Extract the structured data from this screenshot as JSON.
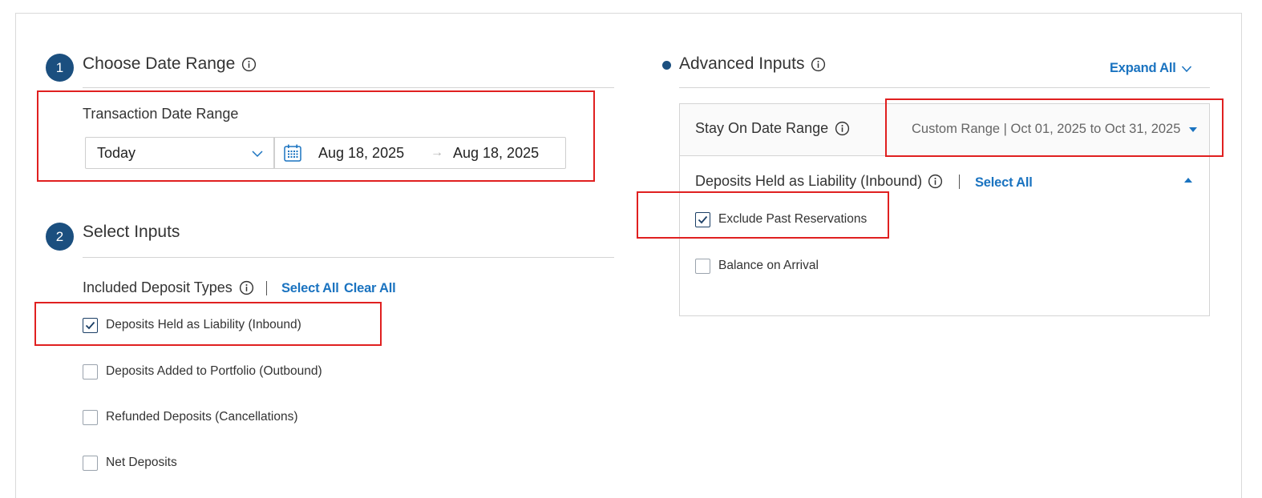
{
  "left": {
    "step1": {
      "number": "1",
      "title": "Choose Date Range",
      "field_label": "Transaction Date Range",
      "preset_value": "Today",
      "start_date": "Aug 18, 2025",
      "arrow": "→",
      "end_date": "Aug 18, 2025"
    },
    "step2": {
      "number": "2",
      "title": "Select Inputs",
      "group_label": "Included Deposit Types",
      "select_all": "Select All",
      "clear_all": "Clear All",
      "options": [
        {
          "label": "Deposits Held as Liability (Inbound)",
          "checked": true
        },
        {
          "label": "Deposits Added to Portfolio (Outbound)",
          "checked": false
        },
        {
          "label": "Refunded Deposits (Cancellations)",
          "checked": false
        },
        {
          "label": "Net Deposits",
          "checked": false
        }
      ]
    }
  },
  "right": {
    "title": "Advanced Inputs",
    "expand_all": "Expand All",
    "stay_range": {
      "label": "Stay On Date Range",
      "value": "Custom Range | Oct 01, 2025 to Oct 31, 2025"
    },
    "inbound_group": {
      "label": "Deposits Held as Liability (Inbound)",
      "select_all": "Select All",
      "options": [
        {
          "label": "Exclude Past Reservations",
          "checked": true
        },
        {
          "label": "Balance on Arrival",
          "checked": false
        }
      ]
    }
  },
  "colors": {
    "accent": "#1a73c0",
    "badge": "#1b4f7f",
    "highlight": "#e02020"
  },
  "icons": [
    "info-icon",
    "chevron-down-icon",
    "calendar-icon",
    "arrow-right-icon",
    "checkmark-icon",
    "caret-down-icon",
    "caret-up-icon"
  ]
}
